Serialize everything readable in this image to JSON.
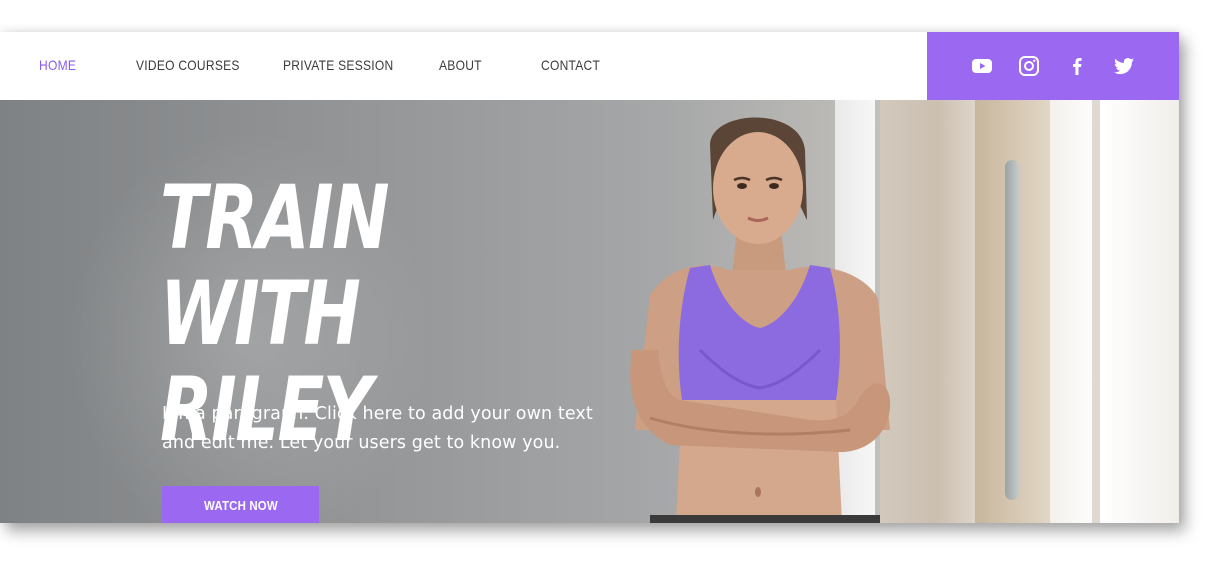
{
  "nav": {
    "items": [
      {
        "label": "HOME",
        "active": true
      },
      {
        "label": "VIDEO COURSES",
        "active": false
      },
      {
        "label": "PRIVATE SESSION",
        "active": false
      },
      {
        "label": "ABOUT",
        "active": false
      },
      {
        "label": "CONTACT",
        "active": false
      }
    ],
    "active_color": "#8a5cf0"
  },
  "social": {
    "background": "#9b68f2",
    "icons": [
      "youtube-icon",
      "instagram-icon",
      "facebook-icon",
      "twitter-icon"
    ]
  },
  "hero": {
    "title": "TRAIN WITH\nRILEY",
    "paragraph": "I'm a paragraph. Click here to add your own text and edit me. Let your users get to know you.",
    "button_label": "WATCH NOW"
  }
}
